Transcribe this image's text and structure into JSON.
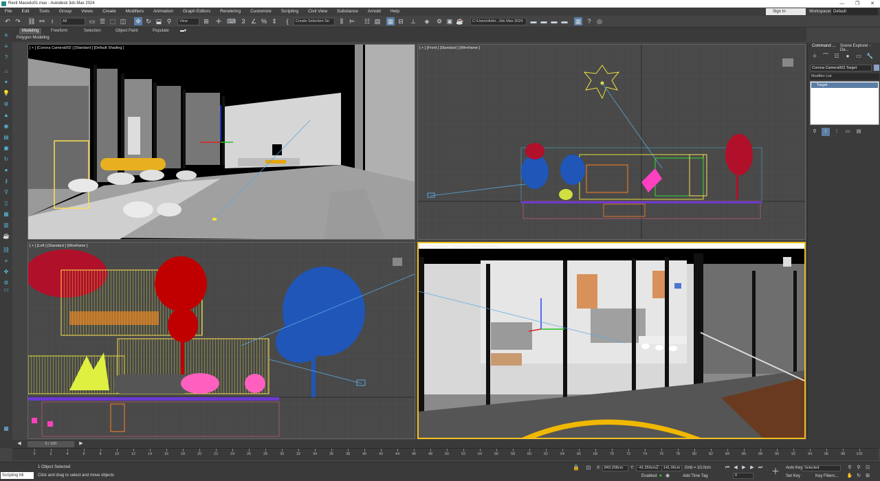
{
  "window": {
    "title": "Revit Macedo01.max - Autodesk 3ds Max 2024",
    "controls": [
      "—",
      "❐",
      "✕"
    ]
  },
  "menu": [
    "File",
    "Edit",
    "Tools",
    "Group",
    "Views",
    "Create",
    "Modifiers",
    "Animation",
    "Graph Editors",
    "Rendering",
    "Customize",
    "Scripting",
    "Civil View",
    "Substance",
    "Arnold",
    "Help"
  ],
  "signin": "Sign In",
  "workspaces": {
    "label": "Workspaces:",
    "value": "Default"
  },
  "toolbar": {
    "filter": "All",
    "coord": "View",
    "selection_set": "Create Selection Se",
    "project_path": "C:\\Users\\Adm...3ds Max 2024"
  },
  "ribbon": {
    "tabs": [
      "Modeling",
      "Freeform",
      "Selection",
      "Object Paint",
      "Populate"
    ],
    "active_tab": "Modeling",
    "sub": "Polygon Modeling"
  },
  "viewports": {
    "tl": "[ + ] [Corona Camera002 ] [Standard ] [Default Shading ]",
    "tr": "[ + ] [Front ] [Standard ] [Wireframe ]",
    "bl": "[ + ] [Left ] [Standard ] [Wireframe ]",
    "br": "[ + ] [Perspective ] [Standard ] [Default Shading ]"
  },
  "command_panel": {
    "tabs": [
      "Command ...",
      "Scene Explorer - De..."
    ],
    "object_name": "Corona Camera002.Target",
    "modifier_list": "Modifier List",
    "stack_item": "Target"
  },
  "timeline": {
    "slider": "0 / 100",
    "ticks": [
      "0",
      "2",
      "4",
      "6",
      "8",
      "10",
      "12",
      "14",
      "16",
      "18",
      "20",
      "22",
      "24",
      "26",
      "28",
      "30",
      "32",
      "34",
      "36",
      "38",
      "40",
      "42",
      "44",
      "46",
      "48",
      "50",
      "52",
      "54",
      "56",
      "58",
      "60",
      "62",
      "64",
      "66",
      "68",
      "70",
      "72",
      "74",
      "76",
      "78",
      "80",
      "82",
      "84",
      "86",
      "88",
      "90",
      "92",
      "94",
      "96",
      "98",
      "100"
    ]
  },
  "status": {
    "maxscript": "Scripting Mi",
    "selected": "1 Object Selected",
    "prompt": "Click and drag to select and move objects",
    "x_label": "X:",
    "x": "843.208cm",
    "y_label": "Y:",
    "y": "-41.259cm",
    "z_label": "Z:",
    "z": "141.06cm",
    "grid": "Grid = 10.0cm",
    "enabled": "Enabled:",
    "add_time_tag": "Add Time Tag",
    "auto_key": "Auto Key",
    "set_key": "Set Key",
    "selected_dd": "Selected",
    "key_filters": "Key Filters...",
    "frame": "0"
  }
}
